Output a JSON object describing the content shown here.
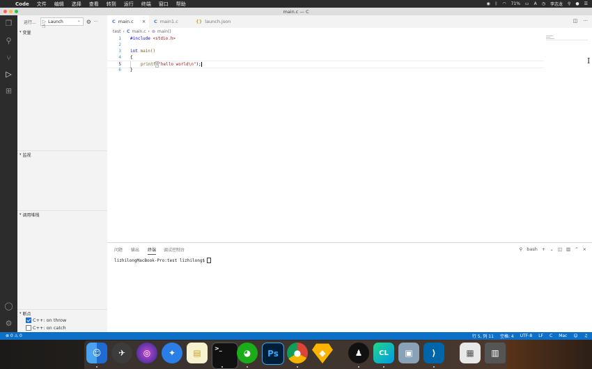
{
  "menubar": {
    "apple": "",
    "app_name": "Code",
    "items": [
      "文件",
      "编辑",
      "选择",
      "查看",
      "转到",
      "运行",
      "终端",
      "窗口",
      "帮助"
    ],
    "battery": "71%",
    "input_method": "A",
    "user": "李志龙"
  },
  "window": {
    "title": "main.c — C"
  },
  "debug": {
    "run_label": "运行...",
    "config": "Launch"
  },
  "sidebar": {
    "variables": "变量",
    "watch": "监视",
    "callstack": "调用堆栈",
    "breakpoints": "断点",
    "breakpoint_items": [
      {
        "label": "C++: on throw",
        "checked": true
      },
      {
        "label": "C++: on catch",
        "checked": false
      }
    ]
  },
  "tabs": [
    {
      "icon": "C",
      "label": "main.c",
      "active": true
    },
    {
      "icon": "C",
      "label": "main1.c",
      "active": false
    },
    {
      "icon": "{}",
      "label": "launch.json",
      "active": false
    }
  ],
  "breadcrumb": {
    "folder": "test",
    "file_icon": "C",
    "file": "main.c",
    "symbol": "main()"
  },
  "code": {
    "line_numbers": [
      "1",
      "2",
      "3",
      "4",
      "5",
      "6"
    ],
    "l1_kw": "#include",
    "l1_str": "<stdio.h>",
    "l3_kw": "int",
    "l3_fn": "main()",
    "l4": "{",
    "l5_fn": "printf",
    "l5_open": "(",
    "l5_str": "\"hello world\\n\"",
    "l5_close": ");",
    "l6": "}"
  },
  "panel": {
    "tabs": [
      "问题",
      "输出",
      "终端",
      "调试控制台"
    ],
    "active_tab": "终端",
    "shell": "bash",
    "terminal_prompt": "lizhilongMacBook-Pro:test lizhilong$"
  },
  "statusbar": {
    "errors": "⊗ 0 ⚠ 0",
    "position": "行 5, 列 11",
    "spaces": "空格: 4",
    "encoding": "UTF-8",
    "eol": "LF",
    "language": "C",
    "platform": "Mac"
  },
  "colors": {
    "statusbar": "#0e6fc7",
    "activity_bar": "#2c2c2c",
    "sidebar": "#f3f3f3",
    "keyword": "#0000ff",
    "string": "#a31515"
  }
}
